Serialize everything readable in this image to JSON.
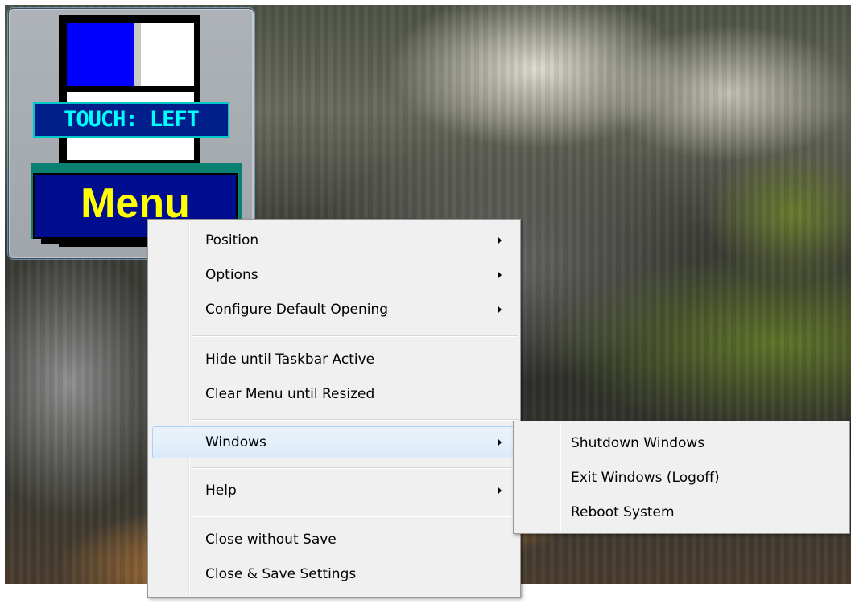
{
  "tool_window": {
    "touch_label": "TOUCH: LEFT",
    "menu_button_label": "Menu"
  },
  "context_menu": {
    "items": [
      {
        "label": "Position",
        "has_submenu": true
      },
      {
        "label": "Options",
        "has_submenu": true
      },
      {
        "label": "Configure Default Opening",
        "has_submenu": true
      },
      {
        "label": "Hide until Taskbar Active",
        "has_submenu": false
      },
      {
        "label": "Clear Menu until Resized",
        "has_submenu": false
      },
      {
        "label": "Windows",
        "has_submenu": true,
        "highlighted": true
      },
      {
        "label": "Help",
        "has_submenu": true
      },
      {
        "label": "Close without Save",
        "has_submenu": false
      },
      {
        "label": "Close & Save Settings",
        "has_submenu": false
      }
    ]
  },
  "windows_submenu": {
    "items": [
      {
        "label": "Shutdown Windows"
      },
      {
        "label": "Exit Windows (Logoff)"
      },
      {
        "label": "Reboot System"
      }
    ]
  },
  "colors": {
    "menu_background": "#f0f0f0",
    "highlight_border": "#aecff7",
    "touch_label_text": "#00ffff",
    "menu_button_text": "#ffff00",
    "menu_button_fill": "#000d8f",
    "tile_blue": "#0000ff"
  },
  "icons": {
    "submenu_arrow": "chevron-right-icon"
  }
}
